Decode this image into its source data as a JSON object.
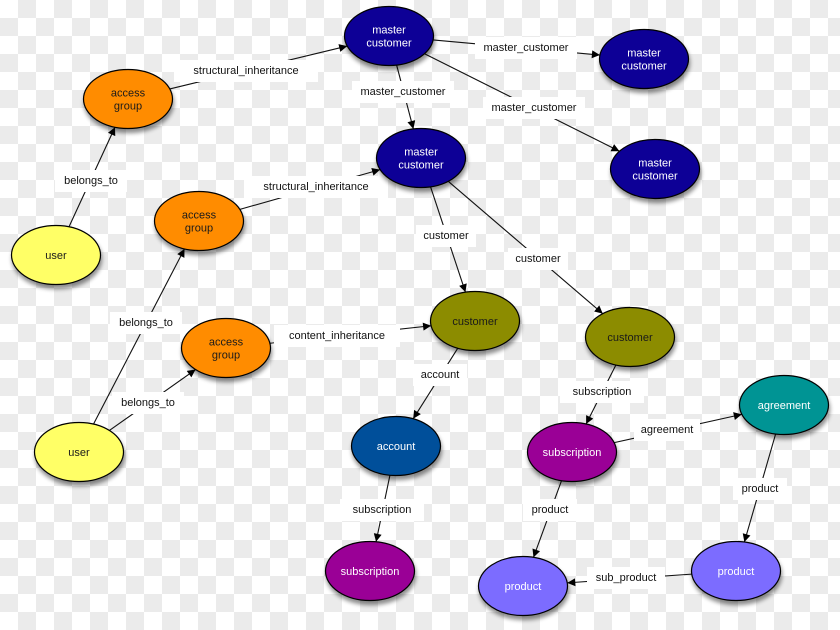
{
  "diagram": {
    "title": "",
    "nodes": [
      {
        "id": "mc1",
        "lines": [
          "master",
          "customer"
        ],
        "type": "master_customer"
      },
      {
        "id": "mc2",
        "lines": [
          "master",
          "customer"
        ],
        "type": "master_customer"
      },
      {
        "id": "mc3",
        "lines": [
          "master",
          "customer"
        ],
        "type": "master_customer"
      },
      {
        "id": "mc4",
        "lines": [
          "master",
          "customer"
        ],
        "type": "master_customer"
      },
      {
        "id": "ag1",
        "lines": [
          "access",
          "group"
        ],
        "type": "access_group"
      },
      {
        "id": "ag2",
        "lines": [
          "access",
          "group"
        ],
        "type": "access_group"
      },
      {
        "id": "ag3",
        "lines": [
          "access",
          "group"
        ],
        "type": "access_group"
      },
      {
        "id": "u1",
        "lines": [
          "user"
        ],
        "type": "user"
      },
      {
        "id": "u2",
        "lines": [
          "user"
        ],
        "type": "user"
      },
      {
        "id": "c1",
        "lines": [
          "customer"
        ],
        "type": "customer"
      },
      {
        "id": "c2",
        "lines": [
          "customer"
        ],
        "type": "customer"
      },
      {
        "id": "acc",
        "lines": [
          "account"
        ],
        "type": "account"
      },
      {
        "id": "s1",
        "lines": [
          "subscription"
        ],
        "type": "subscription"
      },
      {
        "id": "s2",
        "lines": [
          "subscription"
        ],
        "type": "subscription"
      },
      {
        "id": "agr",
        "lines": [
          "agreement"
        ],
        "type": "agreement"
      },
      {
        "id": "p1",
        "lines": [
          "product"
        ],
        "type": "product"
      },
      {
        "id": "p2",
        "lines": [
          "product"
        ],
        "type": "product"
      }
    ],
    "edges": [
      {
        "from": "ag1",
        "to": "mc1",
        "label": "structural_inheritance"
      },
      {
        "from": "mc1",
        "to": "mc3",
        "label": "master_customer"
      },
      {
        "from": "mc1",
        "to": "mc2",
        "label": "master_customer"
      },
      {
        "from": "mc1",
        "to": "mc4",
        "label": "master_customer"
      },
      {
        "from": "u1",
        "to": "ag1",
        "label": "belongs_to"
      },
      {
        "from": "ag2",
        "to": "mc2",
        "label": "structural_inheritance"
      },
      {
        "from": "mc2",
        "to": "c1",
        "label": "customer"
      },
      {
        "from": "mc2",
        "to": "c2",
        "label": "customer"
      },
      {
        "from": "u2",
        "to": "ag2",
        "label": "belongs_to"
      },
      {
        "from": "u2",
        "to": "ag3",
        "label": "belongs_to"
      },
      {
        "from": "ag3",
        "to": "c1",
        "label": "content_inheritance"
      },
      {
        "from": "c1",
        "to": "acc",
        "label": "account"
      },
      {
        "from": "c2",
        "to": "s2",
        "label": "subscription"
      },
      {
        "from": "s2",
        "to": "agr",
        "label": "agreement"
      },
      {
        "from": "acc",
        "to": "s1",
        "label": "subscription"
      },
      {
        "from": "s2",
        "to": "p1",
        "label": "product"
      },
      {
        "from": "agr",
        "to": "p2",
        "label": "product"
      },
      {
        "from": "p2",
        "to": "p1",
        "label": "sub_product"
      }
    ],
    "node_styles": {
      "master_customer": {
        "fill": "#0c0096",
        "text": "#ffffff"
      },
      "access_group": {
        "fill": "#ff8c00",
        "text": "#1a1a1a"
      },
      "user": {
        "fill": "#ffff66",
        "text": "#1a1a1a"
      },
      "customer": {
        "fill": "#8c8c00",
        "text": "#1a1a1a"
      },
      "account": {
        "fill": "#00509a",
        "text": "#ffffff"
      },
      "subscription": {
        "fill": "#9a0096",
        "text": "#ffffff"
      },
      "agreement": {
        "fill": "#009494",
        "text": "#ffffff"
      },
      "product": {
        "fill": "#7b6cff",
        "text": "#ffffff"
      }
    }
  }
}
